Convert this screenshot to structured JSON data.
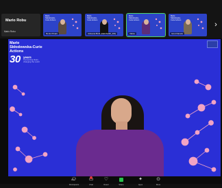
{
  "self_view": {
    "name": "Mario Robu",
    "sub": "Mario Robu"
  },
  "thumbnails": [
    {
      "name": "Denis Pinaru",
      "logo": "Marie Skłodowska-Curie Actions"
    },
    {
      "name": "Adreana Bobi (UEFISCDI_RO)",
      "logo": "Marie Skłodowska-Curie Actions"
    },
    {
      "name": "Vânia",
      "logo": "Marie Skłodowska-Curie Actions"
    },
    {
      "name": "Ionut Danetu",
      "logo": "Marie Skłodowska-Curie Actions"
    }
  ],
  "stage": {
    "logo_lines": [
      "Marie",
      "Skłodowska-Curie",
      "Actions"
    ],
    "big_number": "30",
    "years": "years",
    "tagline": "Connecting ideas, changing the world"
  },
  "toolbar": {
    "participants_count": "151",
    "items": [
      "Participants",
      "Chat",
      "React",
      "Share",
      "Apps",
      "More"
    ]
  },
  "colors": {
    "stage_blue": "#2a2fd6",
    "accent_pink": "#f2a3c4",
    "active_green": "#4fd36a"
  }
}
